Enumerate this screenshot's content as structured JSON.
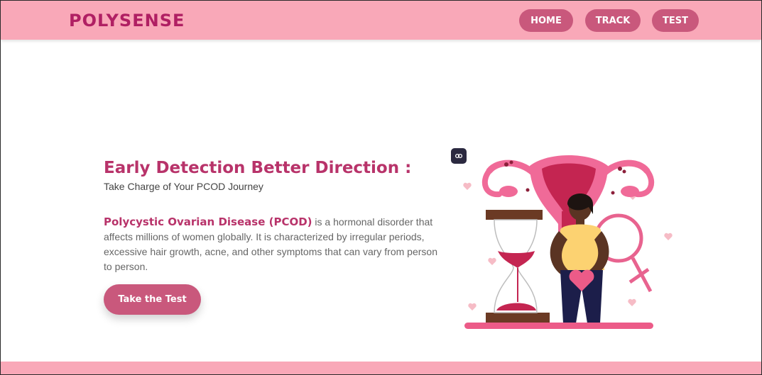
{
  "navbar": {
    "brand": "POLYSENSE",
    "items": [
      {
        "label": "HOME"
      },
      {
        "label": "TRACK"
      },
      {
        "label": "TEST"
      }
    ]
  },
  "hero": {
    "title": "Early Detection Better Direction :",
    "subtitle": "Take Charge of Your PCOD Journey",
    "term": "Polycystic Ovarian Disease (PCOD)",
    "description": " is a hormonal disorder that affects millions of women globally. It is characterized by irregular periods, excessive hair growth, acne, and other symptoms that can vary from person to person.",
    "cta_label": "Take the Test"
  },
  "illustration": {
    "icon": "pcod-illustration",
    "badge_icon": "ai-sparkle-icon"
  },
  "colors": {
    "navbar_bg": "#f9a8b8",
    "brand": "#b01f63",
    "button_bg": "#c9587c",
    "heading": "#b8336a",
    "body_text": "#666666"
  }
}
